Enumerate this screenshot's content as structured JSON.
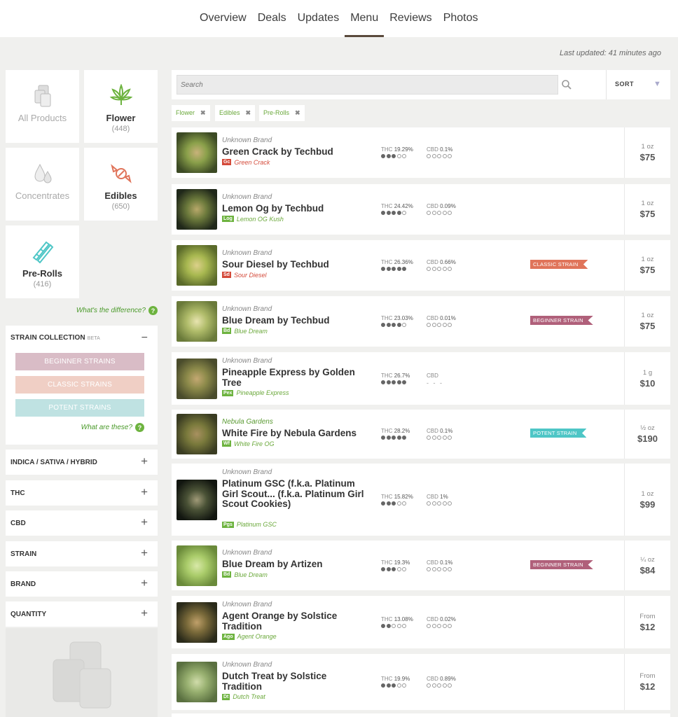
{
  "nav": {
    "tabs": [
      "Overview",
      "Deals",
      "Updates",
      "Menu",
      "Reviews",
      "Photos"
    ],
    "active": "Menu"
  },
  "last_updated": "Last updated: 41 minutes ago",
  "categories": [
    {
      "name": "All Products",
      "count": "",
      "icon": "boxes-icon"
    },
    {
      "name": "Flower",
      "count": "(448)",
      "icon": "leaf-icon"
    },
    {
      "name": "Concentrates",
      "count": "",
      "icon": "drops-icon"
    },
    {
      "name": "Edibles",
      "count": "(650)",
      "icon": "candy-icon"
    },
    {
      "name": "Pre-Rolls",
      "count": "(416)",
      "icon": "prerolls-icon"
    }
  ],
  "difference_link": "What's the difference?",
  "strain_collection": {
    "title": "STRAIN COLLECTION",
    "beta": "BETA",
    "buttons": [
      "BEGINNER STRAINS",
      "CLASSIC STRAINS",
      "POTENT STRAINS"
    ],
    "link": "What are these?"
  },
  "filters": [
    "INDICA / SATIVA / HYBRID",
    "THC",
    "CBD",
    "STRAIN",
    "BRAND",
    "QUANTITY"
  ],
  "search": {
    "placeholder": "Search",
    "sort_label": "SORT"
  },
  "chips": [
    "Flower",
    "Edibles",
    "Pre-Rolls"
  ],
  "products": [
    {
      "brand": "Unknown Brand",
      "name": "Green Crack by Techbud",
      "tag": "Gc",
      "strain": "Green Crack",
      "thc_label": "THC",
      "thc": "19.29%",
      "thc_dots": 3,
      "cbd_label": "CBD",
      "cbd": "0.1%",
      "cbd_dots": 0,
      "ribbon": "",
      "unit": "1 oz",
      "price": "$75"
    },
    {
      "brand": "Unknown Brand",
      "name": "Lemon Og by Techbud",
      "tag": "Log",
      "strain": "Lemon OG Kush",
      "thc_label": "THC",
      "thc": "24.42%",
      "thc_dots": 4,
      "cbd_label": "CBD",
      "cbd": "0.09%",
      "cbd_dots": 0,
      "ribbon": "",
      "unit": "1 oz",
      "price": "$75"
    },
    {
      "brand": "Unknown Brand",
      "name": "Sour Diesel by Techbud",
      "tag": "Sd",
      "strain": "Sour Diesel",
      "thc_label": "THC",
      "thc": "26.36%",
      "thc_dots": 5,
      "cbd_label": "CBD",
      "cbd": "0.66%",
      "cbd_dots": 0,
      "ribbon": "CLASSIC STRAIN",
      "unit": "1 oz",
      "price": "$75"
    },
    {
      "brand": "Unknown Brand",
      "name": "Blue Dream by Techbud",
      "tag": "Bd",
      "strain": "Blue Dream",
      "thc_label": "THC",
      "thc": "23.03%",
      "thc_dots": 4,
      "cbd_label": "CBD",
      "cbd": "0.01%",
      "cbd_dots": 0,
      "ribbon": "BEGINNER STRAIN",
      "unit": "1 oz",
      "price": "$75"
    },
    {
      "brand": "Unknown Brand",
      "name": "Pineapple Express by Golden Tree",
      "tag": "Pex",
      "strain": "Pineapple Express",
      "thc_label": "THC",
      "thc": "26.7%",
      "thc_dots": 5,
      "cbd_label": "CBD",
      "cbd": "",
      "cbd_dots": 0,
      "cbd_nodata": "- - -",
      "ribbon": "",
      "unit": "1 g",
      "price": "$10"
    },
    {
      "brand": "Nebula Gardens",
      "name": "White Fire by Nebula Gardens",
      "tag": "Wf",
      "strain": "White Fire OG",
      "thc_label": "THC",
      "thc": "28.2%",
      "thc_dots": 5,
      "cbd_label": "CBD",
      "cbd": "0.1%",
      "cbd_dots": 0,
      "ribbon": "POTENT STRAIN",
      "unit": "½ oz",
      "price": "$190"
    },
    {
      "brand": "Unknown Brand",
      "name": "Platinum GSC (f.k.a. Platinum Girl Scout... (f.k.a. Platinum Girl Scout Cookies)",
      "tag": "Pgs",
      "strain": "Platinum GSC",
      "thc_label": "THC",
      "thc": "15.82%",
      "thc_dots": 3,
      "cbd_label": "CBD",
      "cbd": "1%",
      "cbd_dots": 0,
      "ribbon": "",
      "unit": "1 oz",
      "price": "$99"
    },
    {
      "brand": "Unknown Brand",
      "name": "Blue Dream by Artizen",
      "tag": "Bd",
      "strain": "Blue Dream",
      "thc_label": "THC",
      "thc": "19.3%",
      "thc_dots": 3,
      "cbd_label": "CBD",
      "cbd": "0.1%",
      "cbd_dots": 0,
      "ribbon": "BEGINNER STRAIN",
      "unit": "¼ oz",
      "price": "$84"
    },
    {
      "brand": "Unknown Brand",
      "name": "Agent Orange by Solstice Tradition",
      "tag": "Ago",
      "strain": "Agent Orange",
      "thc_label": "THC",
      "thc": "13.08%",
      "thc_dots": 2,
      "cbd_label": "CBD",
      "cbd": "0.02%",
      "cbd_dots": 0,
      "ribbon": "",
      "unit": "From",
      "price": "$12"
    },
    {
      "brand": "Unknown Brand",
      "name": "Dutch Treat by Solstice Tradition",
      "tag": "Dt",
      "strain": "Dutch Treat",
      "thc_label": "THC",
      "thc": "19.9%",
      "thc_dots": 3,
      "cbd_label": "CBD",
      "cbd": "0.89%",
      "cbd_dots": 0,
      "ribbon": "",
      "unit": "From",
      "price": "$12"
    }
  ],
  "colors": {
    "beginner": "#b0607a",
    "beginner_btn": "#d9bcc6",
    "classic": "#e0745a",
    "classic_btn": "#f0cfc5",
    "potent": "#4ec6c6",
    "potent_btn": "#bfe2e2",
    "tag_red": "#d44a3a",
    "tag_green": "#6db33f",
    "link_green": "#4a9a2a"
  }
}
